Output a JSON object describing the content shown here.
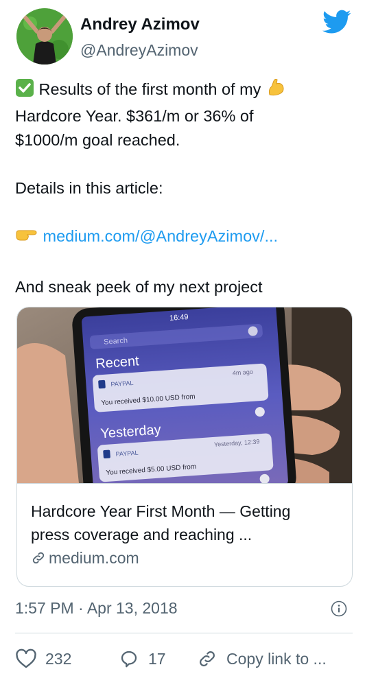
{
  "author": {
    "name": "Andrey Azimov",
    "handle": "@AndreyAzimov"
  },
  "tweet": {
    "line1_prefix_emoji": "✅",
    "line1": "Results of the first month of my",
    "line1_suffix_emoji": "💪",
    "line2": "Hardcore Year. $361/m or 36% of",
    "line3": "$1000/m goal reached.",
    "details": "Details in this article:",
    "pointer_emoji": "👉",
    "link_text": "medium.com/@AndreyAzimov/...",
    "sneak_peek": "And sneak peek of my next project"
  },
  "card": {
    "image": {
      "phone_time": "16:49",
      "search_placeholder": "Search",
      "recent_heading": "Recent",
      "notif1_app": "PAYPAL",
      "notif1_time": "4m ago",
      "notif1_text": "You received $10.00 USD from",
      "yesterday_heading": "Yesterday",
      "notif2_app": "PAYPAL",
      "notif2_time": "Yesterday, 12:39",
      "notif2_text": "You received $5.00 USD from"
    },
    "title_line1": "Hardcore Year First Month — Getting",
    "title_line2": "press coverage and reaching ...",
    "domain": "medium.com"
  },
  "timestamp": "1:57 PM · Apr 13, 2018",
  "actions": {
    "likes": "232",
    "replies": "17",
    "copy_link": "Copy link to ..."
  },
  "colors": {
    "link": "#1d9bf0",
    "secondary_text": "#536471",
    "twitter_blue": "#1d9bf0"
  }
}
